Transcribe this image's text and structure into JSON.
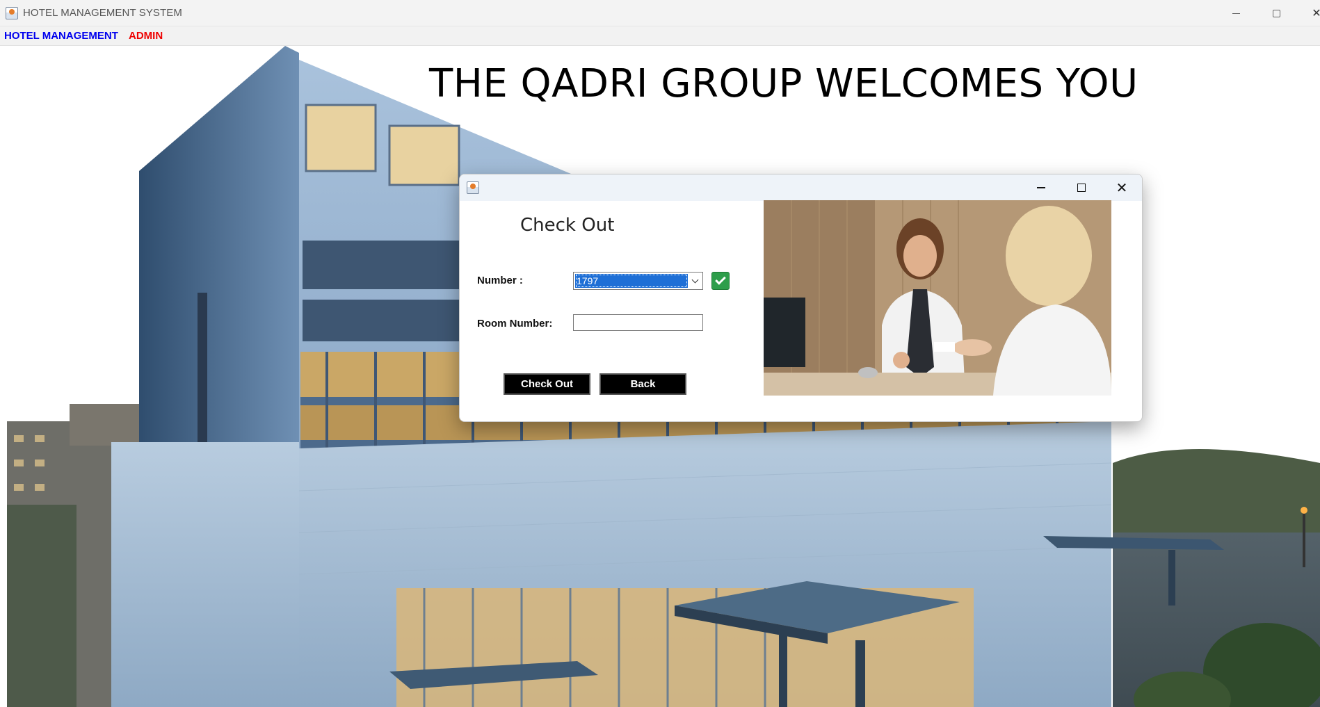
{
  "window": {
    "title": "HOTEL MANAGEMENT SYSTEM"
  },
  "menubar": {
    "items": [
      {
        "label": "HOTEL MANAGEMENT",
        "color": "#0000ee"
      },
      {
        "label": "ADMIN",
        "color": "#ee0000"
      }
    ]
  },
  "main": {
    "welcome_text": "THE QADRI GROUP WELCOMES YOU"
  },
  "dialog": {
    "heading": "Check Out",
    "number_label": "Number :",
    "number_selected": "1797",
    "room_label": "Room Number:",
    "room_value": "",
    "checkout_button": "Check Out",
    "back_button": "Back",
    "check_icon": "check-icon",
    "image_icon": "reception-photo"
  },
  "colors": {
    "selection": "#1e6fd6",
    "button_bg": "#000000",
    "check_green": "#2e9e4b"
  }
}
